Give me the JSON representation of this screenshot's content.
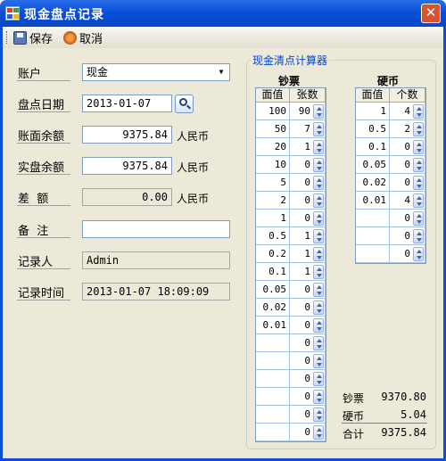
{
  "window": {
    "title": "现金盘点记录",
    "close_glyph": "✕"
  },
  "toolbar": {
    "save_label": "保存",
    "cancel_label": "取消"
  },
  "form": {
    "account_label": "账户",
    "account_value": "现金",
    "date_label": "盘点日期",
    "date_value": "2013-01-07",
    "book_balance_label": "账面余额",
    "book_balance_value": "9375.84",
    "actual_balance_label": "实盘余额",
    "actual_balance_value": "9375.84",
    "diff_label": "差  额",
    "diff_value": "0.00",
    "note_label": "备  注",
    "note_value": "",
    "recorder_label": "记录人",
    "recorder_value": "Admin",
    "time_label": "记录时间",
    "time_value": "2013-01-07 18:09:09",
    "currency_unit": "人民币"
  },
  "calculator": {
    "title": "现金清点计算器",
    "notes_title": "钞票",
    "coins_title": "硬币",
    "col_denomination": "面值",
    "col_count_notes": "张数",
    "col_count_coins": "个数",
    "notes": [
      {
        "denom": "100",
        "count": "90"
      },
      {
        "denom": "50",
        "count": "7"
      },
      {
        "denom": "20",
        "count": "1"
      },
      {
        "denom": "10",
        "count": "0"
      },
      {
        "denom": "5",
        "count": "0"
      },
      {
        "denom": "2",
        "count": "0"
      },
      {
        "denom": "1",
        "count": "0"
      },
      {
        "denom": "0.5",
        "count": "1"
      },
      {
        "denom": "0.2",
        "count": "1"
      },
      {
        "denom": "0.1",
        "count": "1"
      },
      {
        "denom": "0.05",
        "count": "0"
      },
      {
        "denom": "0.02",
        "count": "0"
      },
      {
        "denom": "0.01",
        "count": "0"
      },
      {
        "denom": "",
        "count": "0"
      },
      {
        "denom": "",
        "count": "0"
      },
      {
        "denom": "",
        "count": "0"
      },
      {
        "denom": "",
        "count": "0"
      },
      {
        "denom": "",
        "count": "0"
      },
      {
        "denom": "",
        "count": "0"
      }
    ],
    "coins": [
      {
        "denom": "1",
        "count": "4"
      },
      {
        "denom": "0.5",
        "count": "2"
      },
      {
        "denom": "0.1",
        "count": "0"
      },
      {
        "denom": "0.05",
        "count": "0"
      },
      {
        "denom": "0.02",
        "count": "0"
      },
      {
        "denom": "0.01",
        "count": "4"
      },
      {
        "denom": "",
        "count": "0"
      },
      {
        "denom": "",
        "count": "0"
      },
      {
        "denom": "",
        "count": "0"
      }
    ],
    "summary": {
      "notes_label": "钞票",
      "notes_total": "9370.80",
      "coins_label": "硬币",
      "coins_total": "5.04",
      "total_label": "合计",
      "grand_total": "9375.84"
    }
  },
  "colors": {
    "title_bar": "#0a4fd8",
    "window_bg": "#ece9d8",
    "group_title": "#0046d5"
  }
}
